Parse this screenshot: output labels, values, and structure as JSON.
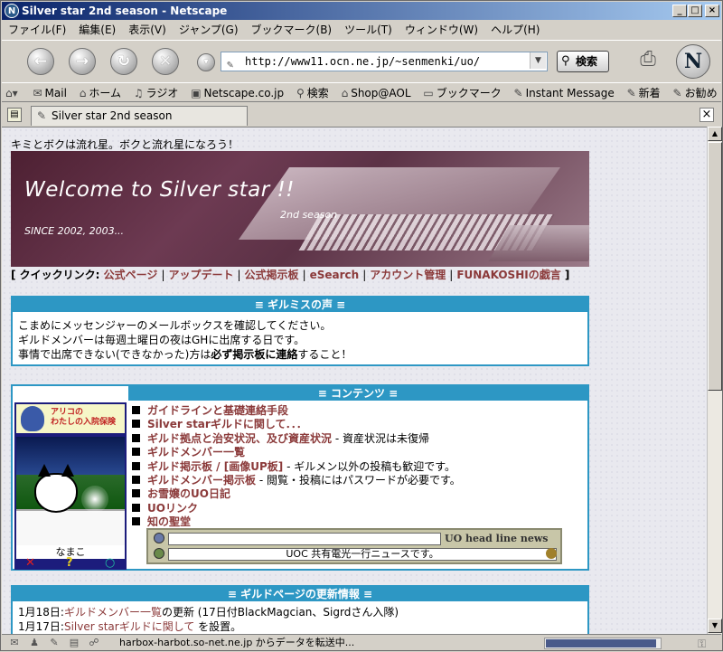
{
  "window": {
    "title": "Silver star 2nd season - Netscape"
  },
  "menu": [
    "ファイル(F)",
    "編集(E)",
    "表示(V)",
    "ジャンプ(G)",
    "ブックマーク(B)",
    "ツール(T)",
    "ウィンドウ(W)",
    "ヘルプ(H)"
  ],
  "nav": {
    "url": "http://www11.ocn.ne.jp/~senmenki/uo/",
    "search_label": "検索"
  },
  "personal_toolbar": [
    "Mail",
    "ホーム",
    "ラジオ",
    "Netscape.co.jp",
    "検索",
    "Shop@AOL",
    "ブックマーク",
    "Instant Message",
    "新着",
    "お勧め"
  ],
  "tab": {
    "label": "Silver star 2nd season"
  },
  "status": {
    "text": "harbox-harbot.so-net.ne.jp からデータを転送中...",
    "progress": 0.97
  },
  "page": {
    "tagline": "キミとボクは流れ星。ボクと流れ星になろう！",
    "banner": {
      "title": "Welcome to Silver star !!",
      "season": "2nd season",
      "since": "SINCE 2002, 2003..."
    },
    "quicklinks": {
      "label": "クイックリンク:",
      "items": [
        "公式ページ",
        "アップデート",
        "公式掲示板",
        "eSearch",
        "アカウント管理",
        "FUNAKOSHIの戯言"
      ]
    },
    "announce": {
      "title": "≡ ギルミスの声 ≡",
      "line1": "こまめにメッセンジャーのメールボックスを確認してください。",
      "line2": "ギルドメンバーは毎週土曜日の夜はGHに出席する日です。",
      "line3_pre": "事情で出席できない(できなかった)方は",
      "line3_bold": "必ず掲示板に連絡",
      "line3_post": "すること！"
    },
    "contents": {
      "title": "≡ コンテンツ ≡",
      "items": [
        {
          "link": "ガイドラインと基礎連絡手段",
          "text": ""
        },
        {
          "link": "Silver starギルドに関して．．．",
          "text": ""
        },
        {
          "link": "ギルド拠点と治安状況、及び資産状況",
          "text": " - 資産状況は未復帰"
        },
        {
          "link": "ギルドメンバー一覧",
          "text": ""
        },
        {
          "link": "ギルド掲示板 / [画像UP板]",
          "text": " - ギルメン以外の投稿も歓迎です。"
        },
        {
          "link": "ギルドメンバー掲示板",
          "text": " - 閲覧・投稿にはパスワードが必要です。"
        },
        {
          "link": "お雪嬢のUO日記",
          "text": ""
        },
        {
          "link": "UOリンク",
          "text": ""
        },
        {
          "link": "知の聖堂",
          "text": ""
        }
      ],
      "character": {
        "banner_text1": "アリコの",
        "banner_text2": "わたしの入院保険",
        "name": "なまこ"
      },
      "news": {
        "title": "UO head line news",
        "message": "UOC 共有電光一行ニュースです。"
      }
    },
    "updates": {
      "title": "≡ ギルドページの更新情報 ≡",
      "rows": [
        {
          "date": "1月18日:",
          "link": "ギルドメンバー一覧",
          "text": "の更新 (17日付BlackMagcian、Sigrdさん入隊)"
        },
        {
          "date": "1月17日:",
          "link": "Silver starギルドに関して",
          "text": " を設置。"
        }
      ]
    }
  }
}
